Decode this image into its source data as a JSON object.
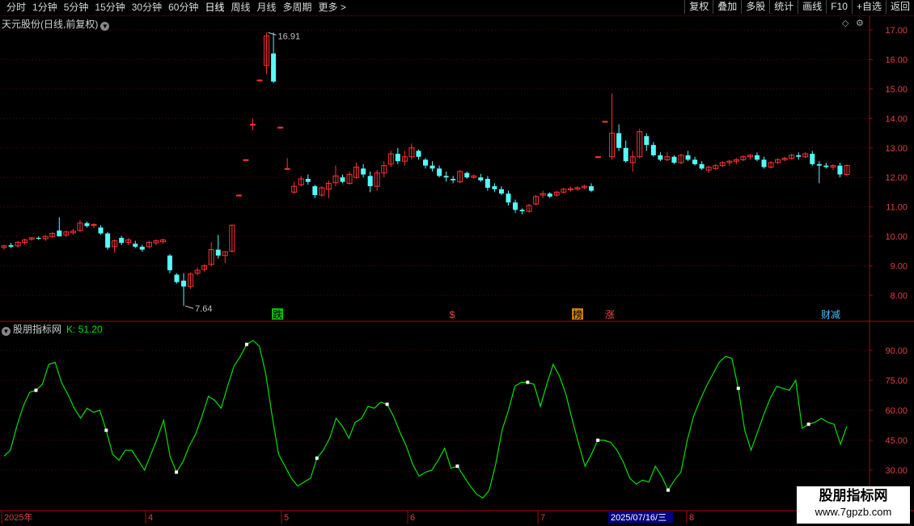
{
  "toolbar": {
    "periods": [
      "分时",
      "1分钟",
      "5分钟",
      "15分钟",
      "30分钟",
      "60分钟",
      "日线",
      "周线",
      "月线",
      "多周期",
      "更多 >"
    ],
    "active_period": "日线",
    "buttons": [
      "复权",
      "叠加",
      "多股",
      "统计",
      "画线",
      "F10",
      "+自选",
      "返回"
    ]
  },
  "main_chart": {
    "title": "天元股份(日线,前复权)",
    "price_axis": [
      "17.00",
      "16.00",
      "15.00",
      "14.00",
      "13.00",
      "12.00",
      "11.00",
      "10.00",
      "9.00",
      "8.00"
    ],
    "high_label": "16.91",
    "low_label": "7.64",
    "events": [
      "跌",
      "$",
      "榜",
      "涨",
      "财减"
    ],
    "colors": {
      "up": "#ff3232",
      "down": "#54fcfc",
      "grid": "#6a0000",
      "axis": "#a00000"
    }
  },
  "indicator": {
    "name": "股朋指标网",
    "k_label": "K: 51.20",
    "axis": [
      "90.00",
      "75.00",
      "60.00",
      "45.00",
      "30.00"
    ],
    "line_color": "#00e000"
  },
  "time_axis": {
    "labels": [
      "2025年",
      "4",
      "5",
      "6",
      "7",
      "8"
    ],
    "cursor_label": "2025/07/16/三"
  },
  "watermark": {
    "line1": "股朋指标网",
    "line2": "www.7gpzb.com"
  },
  "chart_data": {
    "type": "candlestick",
    "ylim": [
      7.3,
      17.2
    ],
    "candles": [
      [
        9.62,
        9.72,
        9.55,
        9.68
      ],
      [
        9.7,
        9.78,
        9.6,
        9.65
      ],
      [
        9.68,
        9.85,
        9.62,
        9.8
      ],
      [
        9.8,
        9.92,
        9.72,
        9.88
      ],
      [
        9.9,
        9.98,
        9.85,
        9.95
      ],
      [
        9.95,
        10.0,
        9.88,
        9.92
      ],
      [
        9.92,
        10.05,
        9.85,
        10.0
      ],
      [
        10.0,
        10.15,
        9.95,
        10.1
      ],
      [
        10.2,
        10.65,
        10.05,
        10.0
      ],
      [
        10.05,
        10.2,
        9.98,
        10.15
      ],
      [
        10.12,
        10.25,
        10.05,
        10.18
      ],
      [
        10.2,
        10.55,
        10.15,
        10.45
      ],
      [
        10.45,
        10.5,
        10.3,
        10.35
      ],
      [
        10.38,
        10.45,
        10.28,
        10.4
      ],
      [
        10.3,
        10.38,
        10.05,
        10.1
      ],
      [
        10.1,
        10.15,
        9.55,
        9.62
      ],
      [
        9.65,
        9.9,
        9.45,
        9.85
      ],
      [
        9.95,
        10.02,
        9.7,
        9.78
      ],
      [
        9.8,
        9.95,
        9.7,
        9.88
      ],
      [
        9.75,
        9.85,
        9.6,
        9.65
      ],
      [
        9.65,
        9.72,
        9.48,
        9.55
      ],
      [
        9.65,
        9.85,
        9.6,
        9.8
      ],
      [
        9.78,
        9.9,
        9.7,
        9.85
      ],
      [
        9.82,
        9.92,
        9.75,
        9.88
      ],
      [
        9.35,
        9.4,
        8.75,
        8.85
      ],
      [
        8.7,
        8.75,
        8.4,
        8.45
      ],
      [
        8.5,
        8.75,
        7.64,
        8.3
      ],
      [
        8.3,
        8.78,
        8.22,
        8.72
      ],
      [
        8.75,
        8.95,
        8.68,
        8.85
      ],
      [
        8.88,
        9.05,
        8.8,
        9.0
      ],
      [
        9.05,
        9.8,
        8.98,
        9.55
      ],
      [
        9.55,
        10.05,
        9.25,
        9.35
      ],
      [
        9.35,
        9.5,
        9.1,
        9.48
      ],
      [
        9.5,
        10.4,
        9.45,
        10.38
      ],
      [
        11.4,
        11.42,
        11.38,
        11.4
      ],
      [
        12.6,
        12.62,
        12.58,
        12.6
      ],
      [
        13.8,
        14.0,
        13.6,
        13.8
      ],
      [
        15.3,
        15.32,
        15.28,
        15.3
      ],
      [
        15.8,
        16.91,
        15.5,
        16.8
      ],
      [
        16.2,
        16.91,
        15.2,
        15.25
      ],
      [
        13.7,
        13.72,
        13.68,
        13.7
      ],
      [
        12.3,
        12.65,
        12.25,
        12.3
      ],
      [
        11.5,
        11.85,
        11.45,
        11.7
      ],
      [
        11.75,
        12.05,
        11.7,
        11.95
      ],
      [
        11.95,
        12.1,
        11.75,
        11.85
      ],
      [
        11.7,
        11.75,
        11.3,
        11.4
      ],
      [
        11.4,
        11.7,
        11.35,
        11.65
      ],
      [
        11.6,
        11.9,
        11.3,
        11.8
      ],
      [
        11.82,
        12.4,
        11.7,
        12.05
      ],
      [
        12.0,
        12.1,
        11.8,
        11.85
      ],
      [
        11.8,
        12.2,
        11.75,
        12.1
      ],
      [
        12.0,
        12.5,
        11.95,
        12.35
      ],
      [
        12.3,
        12.45,
        12.0,
        12.1
      ],
      [
        12.05,
        12.2,
        11.5,
        11.7
      ],
      [
        11.7,
        12.25,
        11.55,
        12.15
      ],
      [
        12.15,
        12.55,
        12.0,
        12.4
      ],
      [
        12.45,
        12.9,
        12.35,
        12.8
      ],
      [
        12.8,
        13.0,
        12.45,
        12.55
      ],
      [
        12.55,
        12.9,
        12.4,
        12.7
      ],
      [
        12.7,
        13.15,
        12.6,
        13.0
      ],
      [
        12.9,
        12.95,
        12.6,
        12.7
      ],
      [
        12.6,
        12.65,
        12.3,
        12.4
      ],
      [
        12.4,
        12.55,
        12.2,
        12.3
      ],
      [
        12.3,
        12.4,
        12.0,
        12.05
      ],
      [
        12.05,
        12.2,
        11.85,
        12.0
      ],
      [
        11.95,
        12.05,
        11.8,
        11.9
      ],
      [
        11.85,
        12.25,
        11.8,
        12.2
      ],
      [
        12.15,
        12.2,
        11.95,
        12.0
      ],
      [
        12.0,
        12.1,
        11.95,
        12.05
      ],
      [
        12.0,
        12.12,
        11.85,
        11.9
      ],
      [
        11.95,
        12.05,
        11.55,
        11.65
      ],
      [
        11.7,
        11.8,
        11.5,
        11.6
      ],
      [
        11.6,
        11.7,
        11.4,
        11.45
      ],
      [
        11.45,
        11.55,
        11.05,
        11.15
      ],
      [
        11.15,
        11.25,
        10.8,
        10.9
      ],
      [
        10.9,
        10.95,
        10.75,
        10.85
      ],
      [
        10.85,
        11.1,
        10.8,
        11.05
      ],
      [
        11.1,
        11.4,
        11.05,
        11.35
      ],
      [
        11.4,
        11.55,
        11.3,
        11.45
      ],
      [
        11.45,
        11.5,
        11.3,
        11.35
      ],
      [
        11.4,
        11.55,
        11.35,
        11.5
      ],
      [
        11.5,
        11.65,
        11.45,
        11.6
      ],
      [
        11.58,
        11.68,
        11.52,
        11.62
      ],
      [
        11.6,
        11.7,
        11.55,
        11.65
      ],
      [
        11.65,
        11.75,
        11.6,
        11.7
      ],
      [
        11.7,
        11.8,
        11.5,
        11.55
      ],
      [
        12.7,
        12.72,
        12.68,
        12.7
      ],
      [
        13.9,
        13.92,
        13.88,
        13.9
      ],
      [
        12.7,
        14.85,
        12.6,
        13.5
      ],
      [
        13.5,
        13.8,
        12.9,
        13.0
      ],
      [
        13.0,
        13.25,
        12.5,
        12.55
      ],
      [
        12.5,
        12.9,
        12.2,
        12.7
      ],
      [
        12.7,
        13.65,
        12.65,
        13.55
      ],
      [
        13.4,
        13.5,
        12.9,
        13.1
      ],
      [
        13.1,
        13.2,
        12.7,
        12.75
      ],
      [
        12.75,
        12.85,
        12.55,
        12.6
      ],
      [
        12.6,
        12.85,
        12.55,
        12.7
      ],
      [
        12.7,
        12.75,
        12.45,
        12.5
      ],
      [
        12.5,
        12.8,
        12.45,
        12.75
      ],
      [
        12.75,
        12.9,
        12.55,
        12.6
      ],
      [
        12.6,
        12.7,
        12.4,
        12.45
      ],
      [
        12.45,
        12.55,
        12.25,
        12.3
      ],
      [
        12.25,
        12.4,
        12.15,
        12.35
      ],
      [
        12.3,
        12.45,
        12.25,
        12.4
      ],
      [
        12.4,
        12.55,
        12.35,
        12.5
      ],
      [
        12.5,
        12.6,
        12.4,
        12.55
      ],
      [
        12.55,
        12.65,
        12.45,
        12.6
      ],
      [
        12.6,
        12.75,
        12.55,
        12.7
      ],
      [
        12.7,
        12.8,
        12.6,
        12.75
      ],
      [
        12.75,
        12.85,
        12.55,
        12.6
      ],
      [
        12.6,
        12.7,
        12.3,
        12.35
      ],
      [
        12.35,
        12.55,
        12.3,
        12.5
      ],
      [
        12.5,
        12.65,
        12.45,
        12.6
      ],
      [
        12.6,
        12.7,
        12.55,
        12.65
      ],
      [
        12.65,
        12.8,
        12.6,
        12.75
      ],
      [
        12.75,
        12.85,
        12.6,
        12.7
      ],
      [
        12.7,
        12.85,
        12.65,
        12.8
      ],
      [
        12.8,
        12.9,
        12.4,
        12.45
      ],
      [
        12.45,
        12.55,
        11.8,
        12.4
      ],
      [
        12.4,
        12.5,
        12.3,
        12.35
      ],
      [
        12.35,
        12.45,
        12.25,
        12.4
      ],
      [
        12.4,
        12.5,
        12.0,
        12.1
      ],
      [
        12.1,
        12.45,
        12.05,
        12.4
      ]
    ],
    "k": [
      37,
      40,
      52,
      62,
      69,
      70,
      73,
      83,
      84,
      74,
      68,
      61,
      56,
      61,
      59,
      60,
      50,
      38,
      35,
      40,
      40,
      35,
      30,
      38,
      46,
      55,
      37,
      29,
      34,
      42,
      48,
      57,
      67,
      65,
      61,
      72,
      82,
      87,
      93,
      95,
      92,
      78,
      57,
      38,
      32,
      26,
      22,
      24,
      26,
      36,
      40,
      46,
      56,
      52,
      46,
      54,
      56,
      62,
      61,
      64,
      63,
      57,
      49,
      42,
      33,
      27,
      29,
      30,
      35,
      41,
      31,
      32,
      27,
      22,
      18,
      16,
      20,
      33,
      50,
      60,
      72,
      74,
      74,
      73,
      62,
      73,
      83,
      77,
      68,
      55,
      43,
      32,
      38,
      45,
      45,
      44,
      40,
      34,
      26,
      23,
      25,
      24,
      32,
      27,
      20,
      25,
      29,
      45,
      57,
      65,
      72,
      78,
      84,
      87,
      86,
      71,
      50,
      40,
      49,
      58,
      66,
      72,
      71,
      70,
      75,
      51,
      53,
      54,
      56,
      54,
      53,
      43,
      52
    ]
  }
}
